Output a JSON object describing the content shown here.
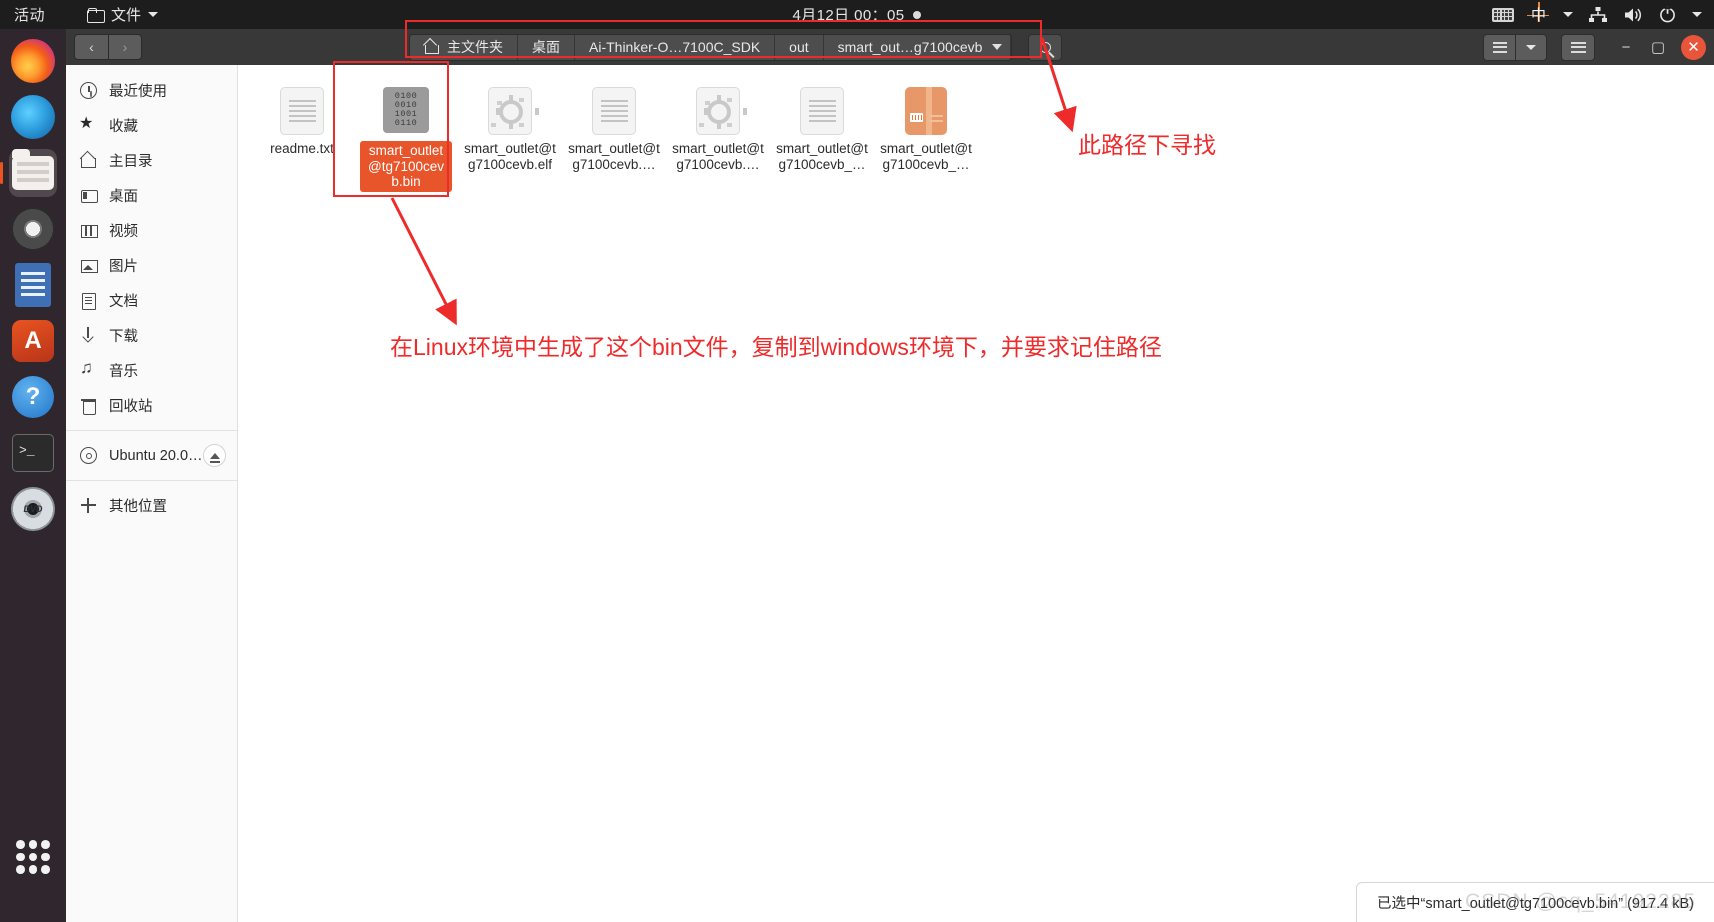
{
  "topbar": {
    "activities": "活动",
    "app_menu": "文件",
    "clock": "4月12日 00：05",
    "tray": {
      "keyboard": "keyboard-icon",
      "input_method": "中",
      "network": "network-icon",
      "volume": "volume-icon",
      "power": "power-icon"
    }
  },
  "dock": {
    "items": [
      {
        "name": "firefox",
        "label": "Firefox"
      },
      {
        "name": "thunderbird",
        "label": "Thunderbird"
      },
      {
        "name": "files",
        "label": "文件"
      },
      {
        "name": "rhythmbox",
        "label": "Rhythmbox"
      },
      {
        "name": "libreoffice-writer",
        "label": "LibreOffice Writer"
      },
      {
        "name": "ubuntu-software",
        "label": "Ubuntu Software"
      },
      {
        "name": "help",
        "label": "帮助"
      },
      {
        "name": "terminal",
        "label": "终端"
      },
      {
        "name": "dvd",
        "label": "DVD"
      }
    ],
    "show_apps": "显示应用程序"
  },
  "window": {
    "nav": {
      "back": "‹",
      "forward": "›"
    },
    "breadcrumbs": [
      {
        "label": "主文件夹",
        "icon": "home-icon"
      },
      {
        "label": "桌面"
      },
      {
        "label": "Ai-Thinker-O…7100C_SDK"
      },
      {
        "label": "out"
      },
      {
        "label": "smart_out…g7100cevb",
        "has_caret": true
      }
    ],
    "search": "search-icon",
    "view_list": "list-view-icon",
    "view_dropdown": "chevron-down-icon",
    "menu": "hamburger-menu-icon",
    "minimize": "−",
    "maximize": "▢",
    "close": "✕"
  },
  "sidebar": {
    "items": [
      {
        "label": "最近使用",
        "icon": "recent-icon"
      },
      {
        "label": "收藏",
        "icon": "star-icon"
      },
      {
        "label": "主目录",
        "icon": "home-icon"
      },
      {
        "label": "桌面",
        "icon": "desktop-icon"
      },
      {
        "label": "视频",
        "icon": "video-icon"
      },
      {
        "label": "图片",
        "icon": "picture-icon"
      },
      {
        "label": "文档",
        "icon": "document-icon"
      },
      {
        "label": "下载",
        "icon": "download-icon"
      },
      {
        "label": "音乐",
        "icon": "music-icon"
      },
      {
        "label": "回收站",
        "icon": "trash-icon"
      }
    ],
    "devices": [
      {
        "label": "Ubuntu 20.0…",
        "icon": "disc-icon",
        "eject": "eject-icon"
      }
    ],
    "other_locations": {
      "label": "其他位置",
      "icon": "plus-icon"
    }
  },
  "files": [
    {
      "name": "readme.txt",
      "icon": "text-file-icon",
      "selected": false
    },
    {
      "name": "smart_outlet@tg7100cevb.bin",
      "icon": "binary-file-icon",
      "selected": true,
      "icon_text": "0100\n0010\n1001\n0110"
    },
    {
      "name": "smart_outlet@tg7100cevb.elf",
      "icon": "executable-file-icon",
      "selected": false
    },
    {
      "name": "smart_outlet@tg7100cevb.…",
      "icon": "text-file-icon",
      "selected": false
    },
    {
      "name": "smart_outlet@tg7100cevb.…",
      "icon": "executable-file-icon",
      "selected": false
    },
    {
      "name": "smart_outlet@tg7100cevb_…",
      "icon": "text-file-icon",
      "selected": false
    },
    {
      "name": "smart_outlet@tg7100cevb_…",
      "icon": "archive-file-icon",
      "selected": false
    }
  ],
  "statusbar": {
    "text": "已选中“smart_outlet@tg7100cevb.bin” (917.4 kB)"
  },
  "watermark": "CSDN @sq_54192285",
  "annotations": [
    {
      "id": "path-hint",
      "text": "此路径下寻找"
    },
    {
      "id": "bin-hint",
      "text": "在Linux环境中生成了这个bin文件，复制到windows环境下，并要求记住路径"
    }
  ],
  "colors": {
    "accent": "#e95420",
    "selection": "#e8552b",
    "annotation": "#ef2a2a",
    "topbar": "#1d1d1d",
    "headerbar": "#383838"
  }
}
